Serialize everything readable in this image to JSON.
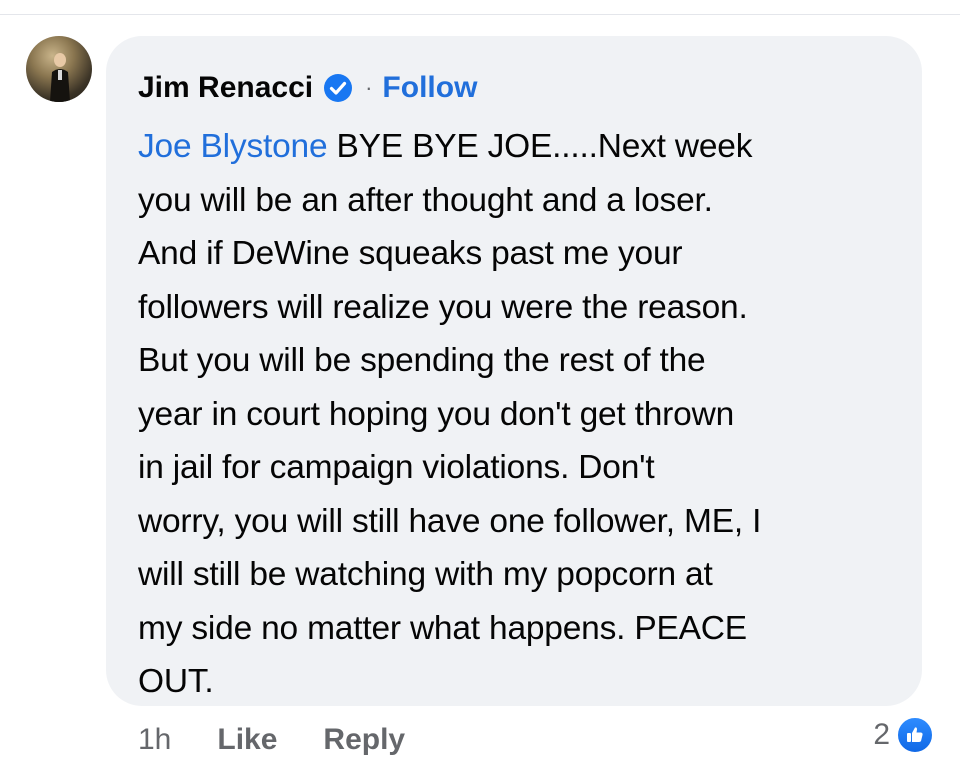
{
  "comment": {
    "author": "Jim Renacci",
    "separator": "·",
    "follow_label": "Follow",
    "mention": "Joe Blystone",
    "text": " BYE BYE JOE.....Next week\nyou will be an after thought and a loser.\nAnd if DeWine squeaks past me your\nfollowers will realize you were the reason.\nBut you will be spending the rest of the\nyear in court hoping you don't get thrown\nin jail for campaign violations.  Don't\nworry, you will still have one follower, ME, I\nwill still be watching with my popcorn at\nmy side no matter what happens. PEACE\nOUT."
  },
  "footer": {
    "time": "1h",
    "like_label": "Like",
    "reply_label": "Reply",
    "reaction_count": "2"
  },
  "icons": {
    "verified": "verified-badge-icon",
    "like_reaction": "thumbs-up-icon"
  },
  "colors": {
    "link_blue": "#216fdb",
    "bubble_bg": "#f0f2f5",
    "muted_text": "#65676b",
    "like_blue": "#1877f2"
  }
}
